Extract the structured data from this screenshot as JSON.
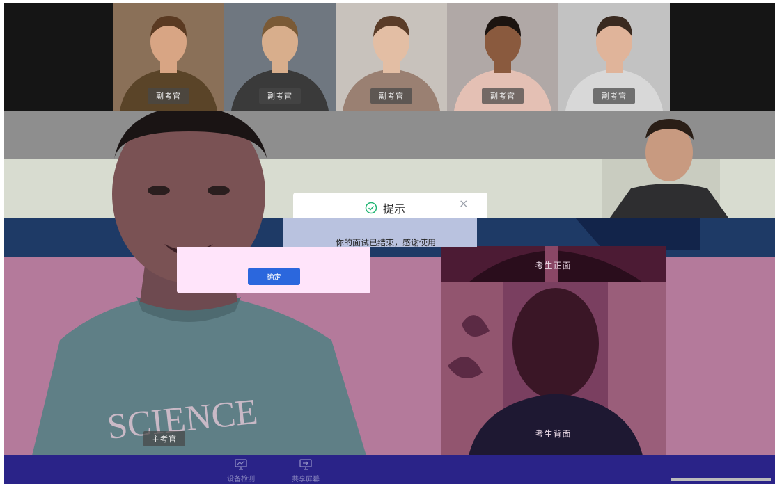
{
  "top_row": {
    "tiles": [
      {
        "label": "副考官",
        "bg": "#8a7058",
        "skin": "#d8a584",
        "clothes": "#5a4428",
        "hair": "#5a3a22"
      },
      {
        "label": "副考官",
        "bg": "#6f7780",
        "skin": "#d8ae8c",
        "clothes": "#3a3a3a",
        "hair": "#7a5a36"
      },
      {
        "label": "副考官",
        "bg": "#c8c2bc",
        "skin": "#e3bea4",
        "clothes": "#9a8072",
        "hair": "#5a3c28"
      },
      {
        "label": "副考官",
        "bg": "#b0a8a6",
        "skin": "#8a5a3e",
        "clothes": "#e4c0b4",
        "hair": "#1c1410"
      },
      {
        "label": "副考官",
        "bg": "#c2c2c2",
        "skin": "#e0b49a",
        "clothes": "#d8d8d8",
        "hair": "#3a2a20"
      }
    ]
  },
  "main_video": {
    "label": "主考官"
  },
  "front_video": {
    "label": "考生正面"
  },
  "back_video": {
    "label": "考生背面"
  },
  "dialog": {
    "title": "提示",
    "message": "你的面试已结束，感谢使用",
    "confirm_label": "确定",
    "close_symbol": "×"
  },
  "toolbar": {
    "device_check_label": "设备检测",
    "share_screen_label": "共享屏幕"
  },
  "colors": {
    "accent": "#2b67dd",
    "success_icon": "#22b573",
    "toolbar": "#2a2388"
  }
}
